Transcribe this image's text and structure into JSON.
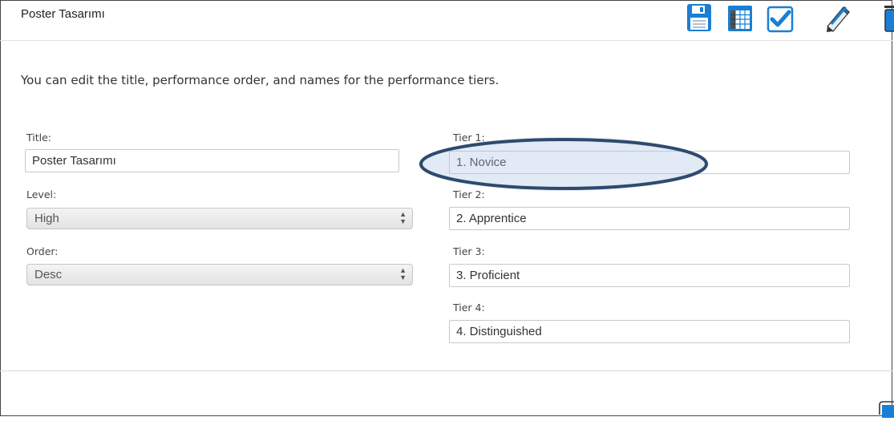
{
  "header": {
    "title": "Poster Tasarımı",
    "toolbar": [
      {
        "name": "save-icon",
        "color": "#1a7fd4"
      },
      {
        "name": "table-icon",
        "color": "#1a7fd4"
      },
      {
        "name": "checkmark-icon",
        "color": "#1a7fd4"
      },
      {
        "name": "pencil-icon",
        "color": "#1a7fd4"
      },
      {
        "name": "trash-icon",
        "color": "#1a7fd4"
      }
    ]
  },
  "main": {
    "instructions": "You can edit the title, performance order, and names for the performance tiers.",
    "title_field": {
      "label": "Title:",
      "value": "Poster Tasarımı"
    },
    "level_field": {
      "label": "Level:",
      "value": "High"
    },
    "order_field": {
      "label": "Order:",
      "value": "Desc"
    },
    "tiers": [
      {
        "label": "Tier 1:",
        "value": "1. Novice"
      },
      {
        "label": "Tier 2:",
        "value": "2. Apprentice"
      },
      {
        "label": "Tier 3:",
        "value": "3. Proficient"
      },
      {
        "label": "Tier 4:",
        "value": "4. Distinguished"
      }
    ]
  },
  "annotation": {
    "ellipse_color": "#2f4a6e",
    "fill_color": "#aac3e1"
  },
  "colors": {
    "accent": "#1a7fd4",
    "input_border": "#c9c9c9"
  }
}
